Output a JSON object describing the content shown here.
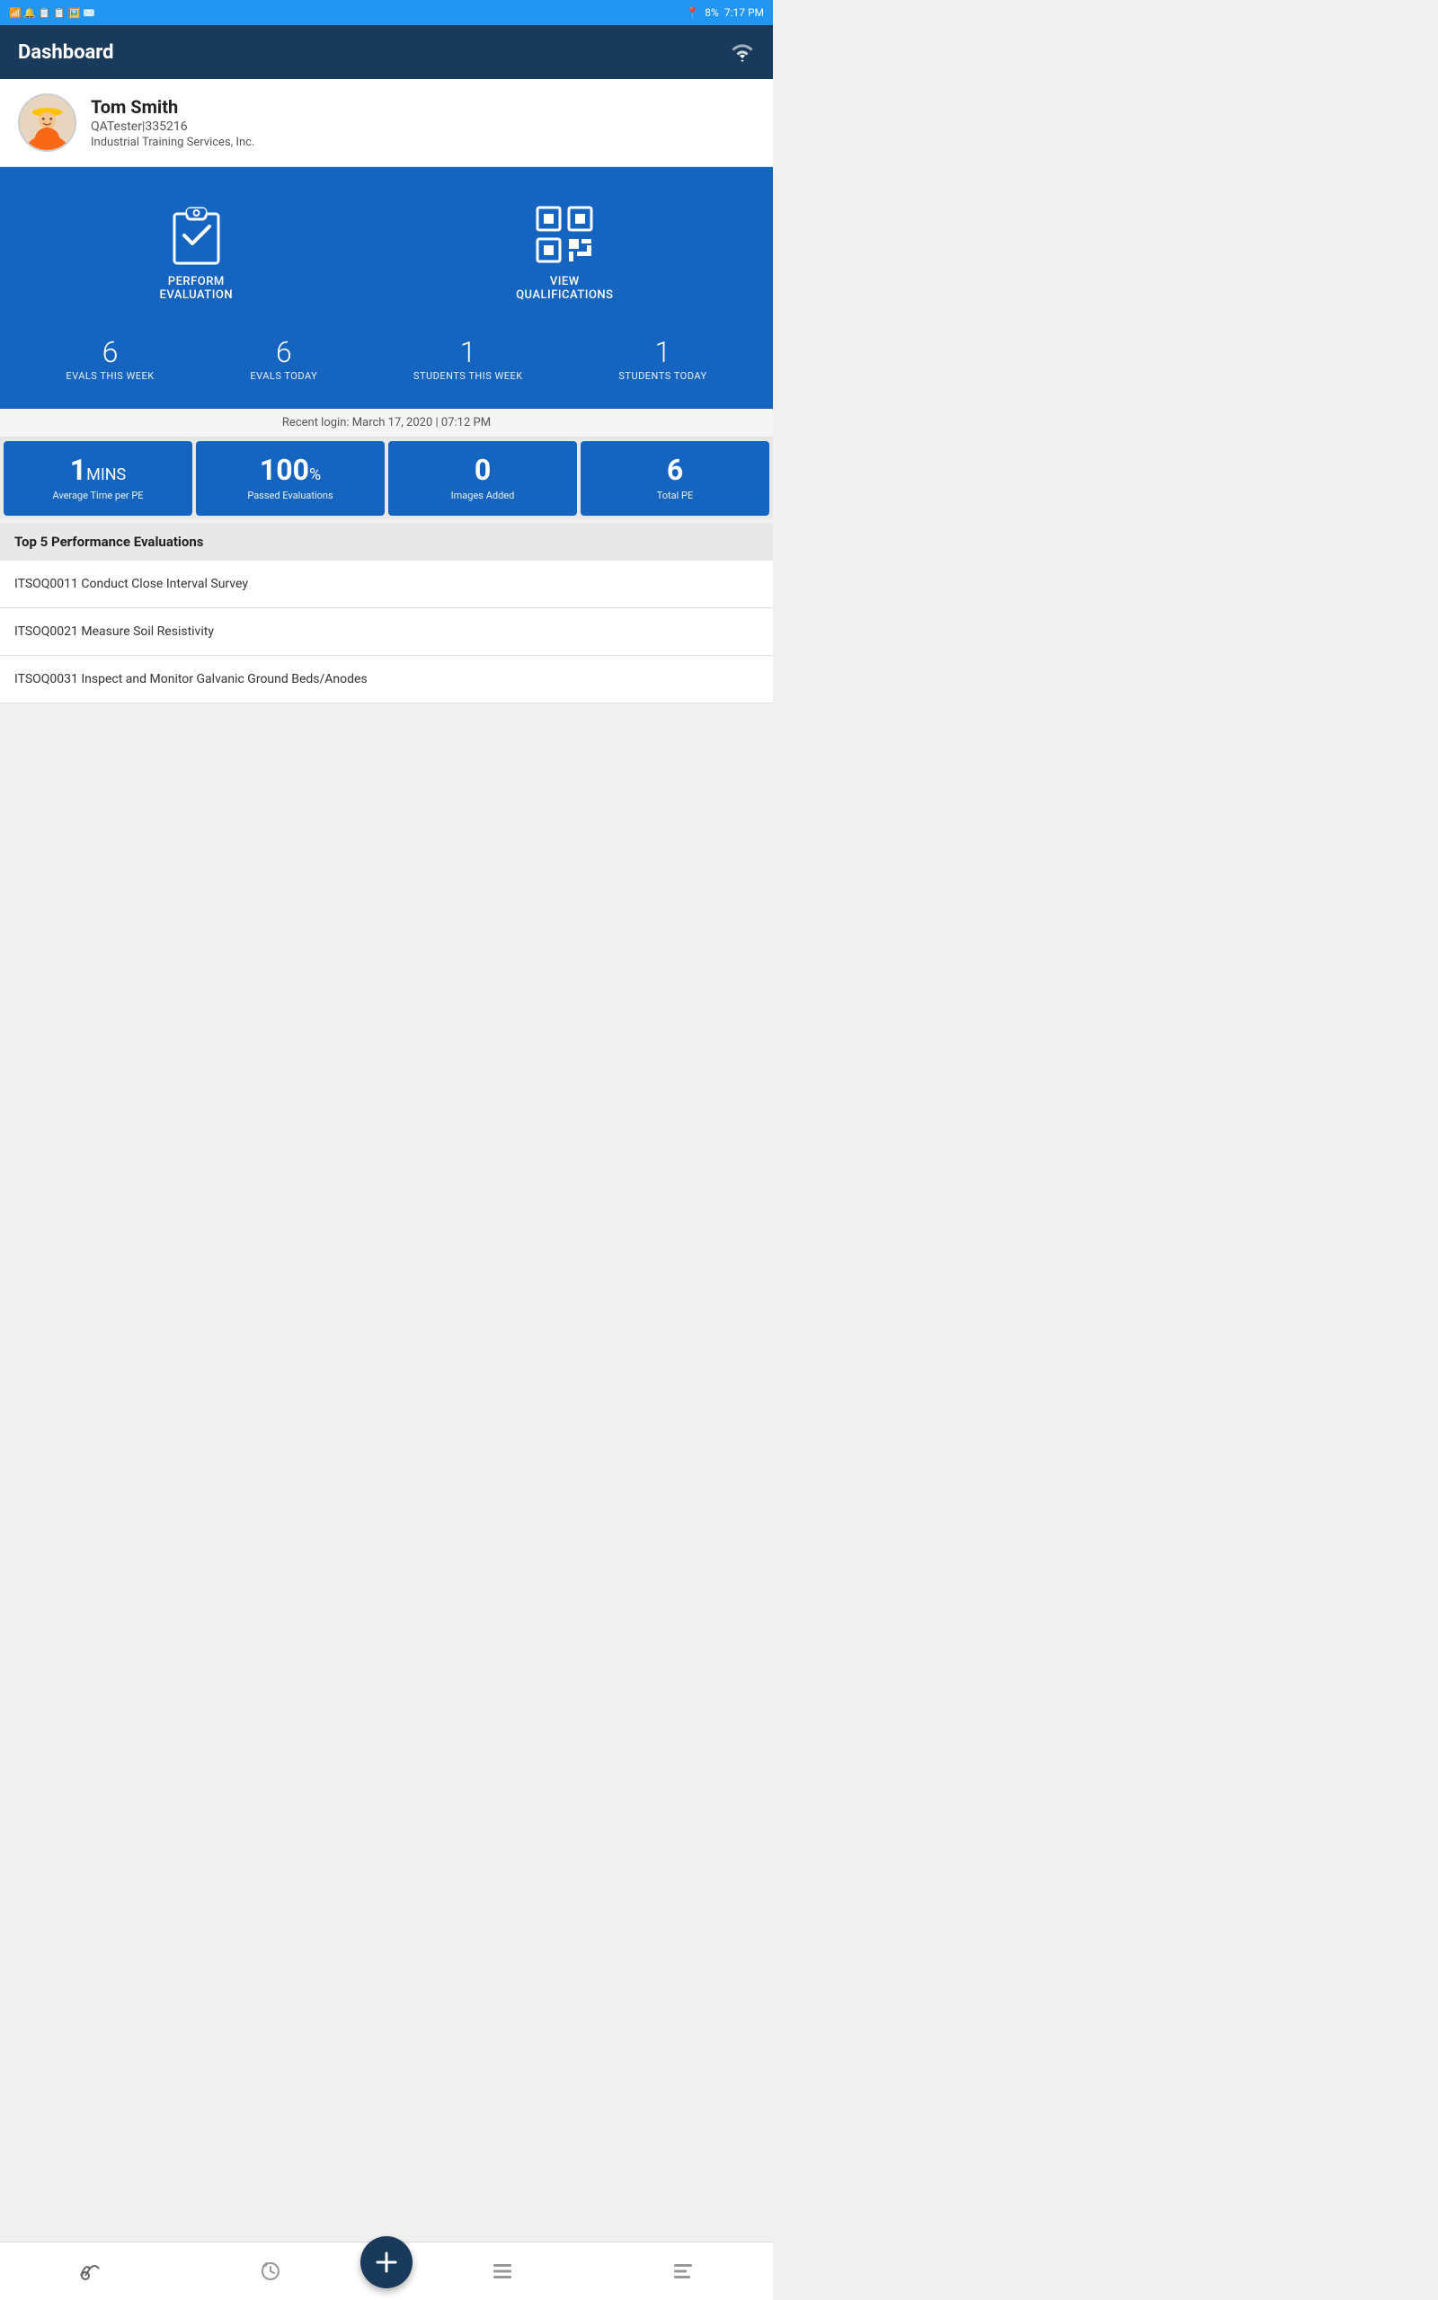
{
  "statusBar": {
    "time": "7:17 PM",
    "battery": "8%"
  },
  "header": {
    "title": "Dashboard",
    "wifi_icon": "wifi"
  },
  "user": {
    "name": "Tom Smith",
    "role": "QATester|335216",
    "company": "Industrial Training Services, Inc."
  },
  "actions": [
    {
      "id": "perform-evaluation",
      "label": "PERFORM\nEVALUATION",
      "icon": "clipboard-check"
    },
    {
      "id": "view-qualifications",
      "label": "VIEW\nQUALIFICATIONS",
      "icon": "qr-code"
    }
  ],
  "stats": [
    {
      "id": "evals-week",
      "value": "6",
      "label": "EVALS THIS WEEK"
    },
    {
      "id": "evals-today",
      "value": "6",
      "label": "EVALS TODAY"
    },
    {
      "id": "students-week",
      "value": "1",
      "label": "STUDENTS THIS WEEK"
    },
    {
      "id": "students-today",
      "value": "1",
      "label": "STUDENTS TODAY"
    }
  ],
  "recentLogin": "Recent login: March 17, 2020 | 07:12 PM",
  "metrics": [
    {
      "id": "avg-time",
      "value": "1",
      "unit": "MINS",
      "label": "Average Time per PE"
    },
    {
      "id": "passed-evals",
      "value": "100",
      "unit": "%",
      "label": "Passed Evaluations"
    },
    {
      "id": "images-added",
      "value": "0",
      "unit": "",
      "label": "Images Added"
    },
    {
      "id": "total-pe",
      "value": "6",
      "unit": "",
      "label": "Total PE"
    }
  ],
  "top5": {
    "header": "Top 5 Performance Evaluations",
    "items": [
      "ITSOQ0011 Conduct Close Interval Survey",
      "ITSOQ0021 Measure Soil Resistivity",
      "ITSOQ0031 Inspect and Monitor Galvanic Ground Beds/Anodes"
    ]
  },
  "bottomNav": {
    "items": [
      {
        "id": "dashboard-nav",
        "icon": "gauge"
      },
      {
        "id": "history-nav",
        "icon": "history"
      },
      {
        "id": "fab",
        "icon": "plus"
      },
      {
        "id": "list-nav",
        "icon": "list"
      },
      {
        "id": "menu-nav",
        "icon": "menu"
      }
    ]
  }
}
